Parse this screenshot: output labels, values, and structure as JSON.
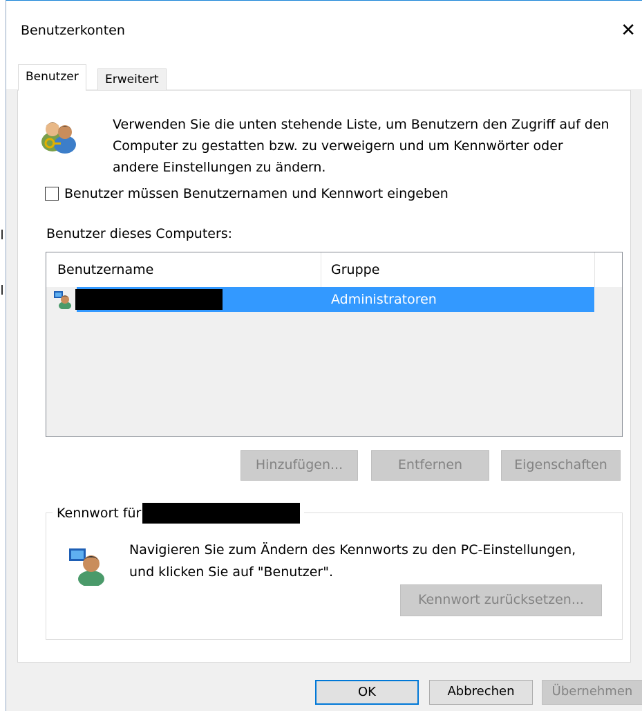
{
  "window": {
    "title": "Benutzerkonten",
    "close_glyph": "✕"
  },
  "tabs": [
    {
      "label": "Benutzer",
      "active": true
    },
    {
      "label": "Erweitert",
      "active": false
    }
  ],
  "intro": {
    "icon": "users-key-icon",
    "text": "Verwenden Sie die unten stehende Liste, um Benutzern den Zugriff auf den Computer zu gestatten bzw. zu verweigern und um Kennwörter oder andere Einstellungen zu ändern."
  },
  "require_login": {
    "label": "Benutzer müssen Benutzernamen und Kennwort eingeben",
    "checked": false
  },
  "users_section": {
    "label": "Benutzer dieses Computers:",
    "columns": [
      "Benutzername",
      "Gruppe"
    ],
    "rows": [
      {
        "username_redacted": true,
        "group": "Administratoren",
        "selected": true
      }
    ]
  },
  "user_buttons": {
    "add": "Hinzufügen...",
    "remove": "Entfernen",
    "properties": "Eigenschaften"
  },
  "password_group": {
    "legend_prefix": "Kennwort für",
    "text": "Navigieren Sie zum Ändern des Kennworts zu den PC-Einstellungen, und klicken Sie auf \"Benutzer\".",
    "reset_button": "Kennwort zurücksetzen..."
  },
  "footer": {
    "ok": "OK",
    "cancel": "Abbrechen",
    "apply": "Übernehmen"
  },
  "colors": {
    "selection": "#3399ff",
    "focus_border": "#0078d7",
    "dialog_bg": "#f0f0f0"
  }
}
